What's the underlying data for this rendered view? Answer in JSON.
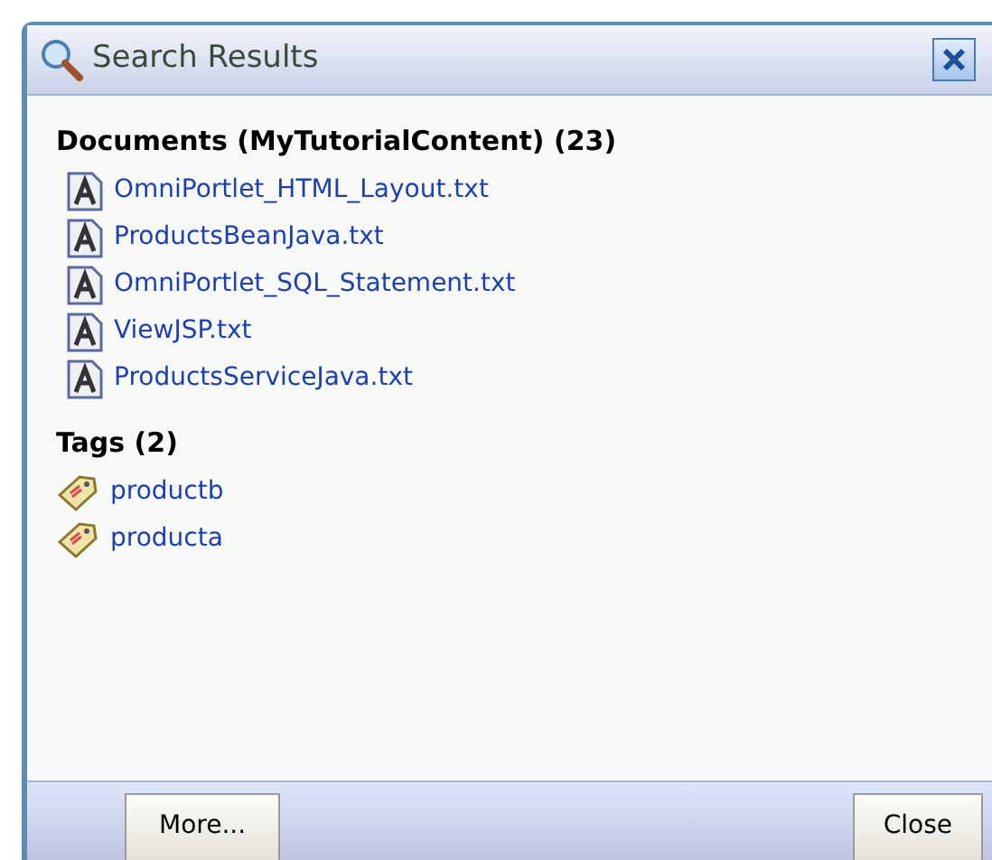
{
  "window": {
    "title": "Search Results"
  },
  "sections": [
    {
      "kind": "documents",
      "heading": "Documents (MyTutorialContent) (23)",
      "items": [
        "OmniPortlet_HTML_Layout.txt",
        "ProductsBeanJava.txt",
        "OmniPortlet_SQL_Statement.txt",
        "ViewJSP.txt",
        "ProductsServiceJava.txt"
      ]
    },
    {
      "kind": "tags",
      "heading": "Tags (2)",
      "items": [
        "productb",
        "producta"
      ]
    }
  ],
  "buttons": [
    "More...",
    "Close"
  ]
}
